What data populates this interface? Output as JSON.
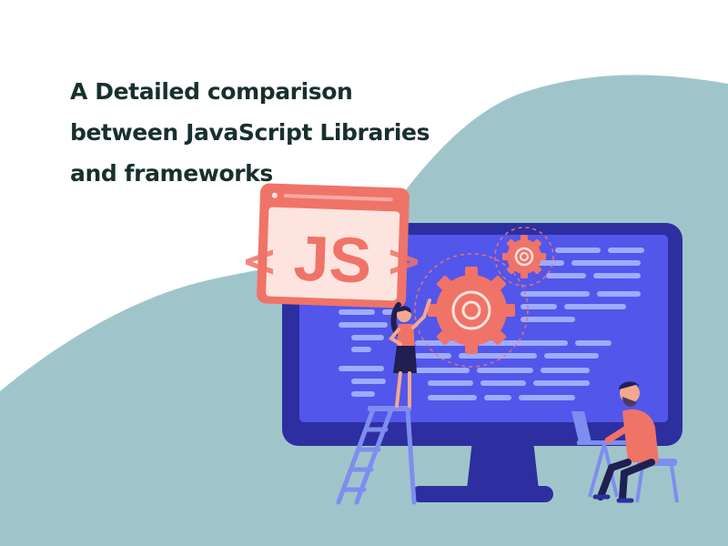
{
  "headline": {
    "line1": "A Detailed comparison",
    "line2": "between JavaScript Libraries",
    "line3": "and frameworks"
  },
  "illustration": {
    "badge_text": "JS",
    "left_chevron": "<",
    "right_chevron": ">"
  },
  "colors": {
    "background": "#ffffff",
    "wave": "#9fc5cb",
    "title_text": "#18302d",
    "monitor_frame": "#2d2fa0",
    "screen": "#5356ea",
    "code_lines": "#a8b6ff",
    "accent_coral": "#f07368",
    "badge_fill": "#fde4de"
  }
}
